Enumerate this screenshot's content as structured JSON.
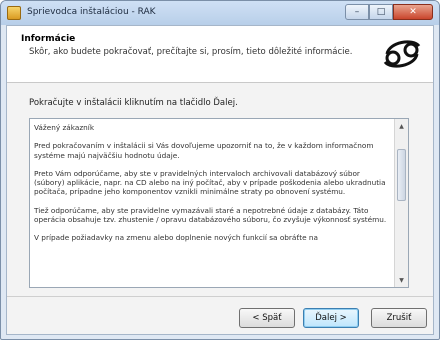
{
  "window": {
    "title": "Sprievodca inštaláciou - RAK"
  },
  "controls": {
    "minimize": "–",
    "maximize": "□",
    "close": "✕"
  },
  "header": {
    "title": "Informácie",
    "subtitle": "Skôr, ako budete pokračovať, prečítajte si, prosím, tieto dôležité informácie."
  },
  "intro_text": "Pokračujte v inštalácii kliknutím na tlačidlo Ďalej.",
  "memo": {
    "text": "Vážený zákazník\n\nPred pokračovaním v inštalácii si Vás dovoľujeme upozorniť na to, že v každom informačnom systéme majú najväčšiu hodnotu údaje.\n\nPreto Vám odporúčame, aby ste v pravidelných intervaloch archivovali databázový súbor (súbory) aplikácie, napr. na CD alebo na iný počítač, aby v prípade poškodenia alebo ukradnutia počítača, prípadne jeho komponentov vznikli minimálne straty po obnovení systému.\n\nTiež odporúčame, aby ste pravidelne vymazávali staré a nepotrebné údaje z databázy. Táto operácia obsahuje tzv. zhustenie / opravu databázového súboru, čo zvyšuje výkonnosť systému.\n\nV prípade požiadavky na zmenu alebo doplnenie nových funkcií sa obráťte na"
  },
  "buttons": {
    "back": "< Späť",
    "next": "Ďalej >",
    "cancel": "Zrušiť"
  },
  "icons": {
    "logo": "cancer-zodiac-icon",
    "scroll_up": "arrow-up-icon",
    "scroll_down": "arrow-down-icon"
  }
}
